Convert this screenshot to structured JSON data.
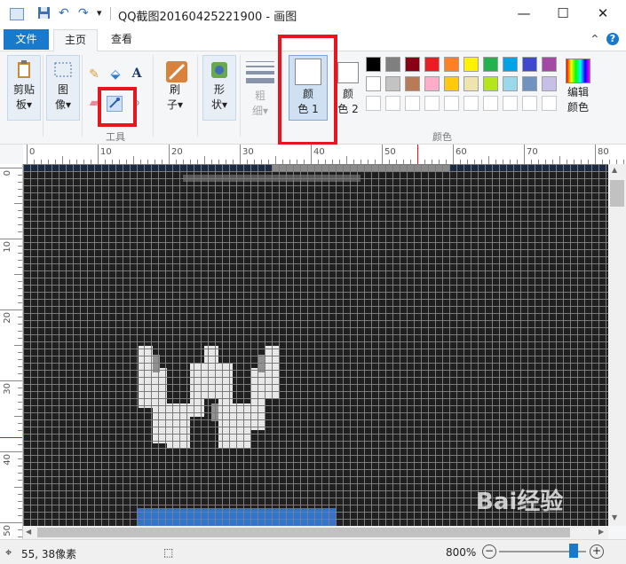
{
  "window": {
    "title": "QQ截图20160425221900 - 画图",
    "minimize": "—",
    "maximize": "☐",
    "close": "✕"
  },
  "quick_access": {
    "save_icon": "save-icon",
    "undo_icon": "undo-icon",
    "redo_icon": "redo-icon",
    "dropdown": "▾"
  },
  "tabs": [
    {
      "label": "文件"
    },
    {
      "label": "主页"
    },
    {
      "label": "查看"
    }
  ],
  "ribbon": {
    "clipboard": {
      "line1": "剪贴",
      "line2": "板▾"
    },
    "image": {
      "line1": "图",
      "line2": "像▾"
    },
    "tools_label": "工具",
    "brushes": {
      "line1": "刷",
      "line2": "子▾"
    },
    "shapes": {
      "line1": "形",
      "line2": "状▾"
    },
    "size": {
      "line1": "粗",
      "line2": "细▾"
    },
    "color1": {
      "line1": "颜",
      "line2": "色 1"
    },
    "color2": {
      "line1": "颜",
      "line2": "色 2"
    },
    "colors_label": "颜色",
    "edit_colors": {
      "line1": "编辑",
      "line2": "颜色"
    },
    "palette_row1": [
      "#000000",
      "#7f7f7f",
      "#880015",
      "#ed1c24",
      "#ff7f27",
      "#fff200",
      "#22b14c",
      "#00a2e8",
      "#3f48cc",
      "#a349a4"
    ],
    "palette_row2": [
      "#ffffff",
      "#c3c3c3",
      "#b97a57",
      "#ffaec9",
      "#ffc90e",
      "#efe4b0",
      "#b5e61d",
      "#99d9ea",
      "#7092be",
      "#c8bfe7"
    ]
  },
  "ruler": {
    "top_labels": [
      "0",
      "10",
      "20",
      "30",
      "40",
      "50",
      "60",
      "70",
      "80"
    ],
    "left_labels": [
      "0",
      "10",
      "20",
      "30",
      "40",
      "50"
    ]
  },
  "status": {
    "position": "55, 38像素",
    "zoom": "800%",
    "zoom_out": "−",
    "zoom_in": "+"
  },
  "colors": {
    "accent": "#1979ca",
    "highlight_box": "#e8141e",
    "canvas_bg": "#1f1f1f"
  }
}
